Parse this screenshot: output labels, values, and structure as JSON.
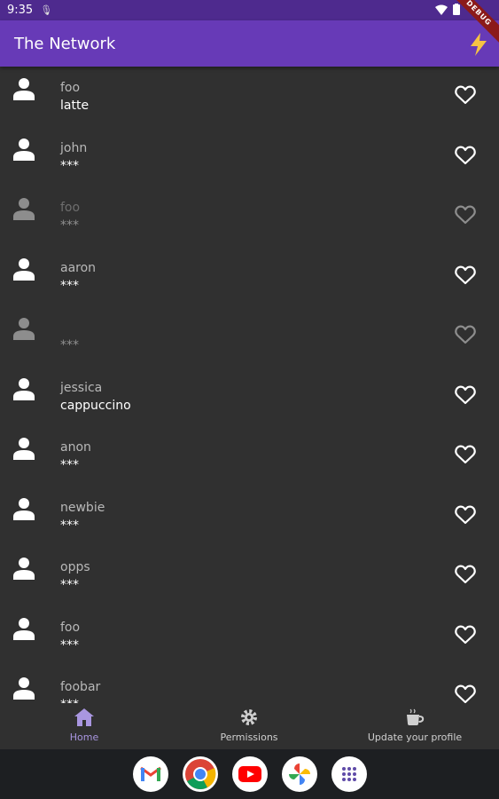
{
  "status_bar": {
    "time": "9:35"
  },
  "app_bar": {
    "title": "The Network"
  },
  "debug_banner": "DEBUG",
  "contacts": [
    {
      "name": "foo",
      "drink": "latte",
      "dim": false
    },
    {
      "name": "john",
      "drink": "***",
      "dim": false
    },
    {
      "name": "foo",
      "drink": "***",
      "dim": true
    },
    {
      "name": "aaron",
      "drink": "***",
      "dim": false
    },
    {
      "name": "",
      "drink": "***",
      "dim": true
    },
    {
      "name": "jessica",
      "drink": "cappuccino",
      "dim": false
    },
    {
      "name": "anon",
      "drink": "***",
      "dim": false
    },
    {
      "name": "newbie",
      "drink": "***",
      "dim": false
    },
    {
      "name": "opps",
      "drink": "***",
      "dim": false
    },
    {
      "name": "foo",
      "drink": "***",
      "dim": false
    },
    {
      "name": "foobar",
      "drink": "***",
      "dim": false
    }
  ],
  "bottom_nav": {
    "home": "Home",
    "permissions": "Permissions",
    "update_profile": "Update your profile"
  },
  "dock": [
    "gmail-icon",
    "chrome-icon",
    "youtube-icon",
    "photos-icon",
    "app-drawer-icon"
  ],
  "colors": {
    "app_bar": "#673ab7",
    "status_bar": "#4e2a8e",
    "background": "#303030",
    "active_nav": "#a996e0"
  }
}
